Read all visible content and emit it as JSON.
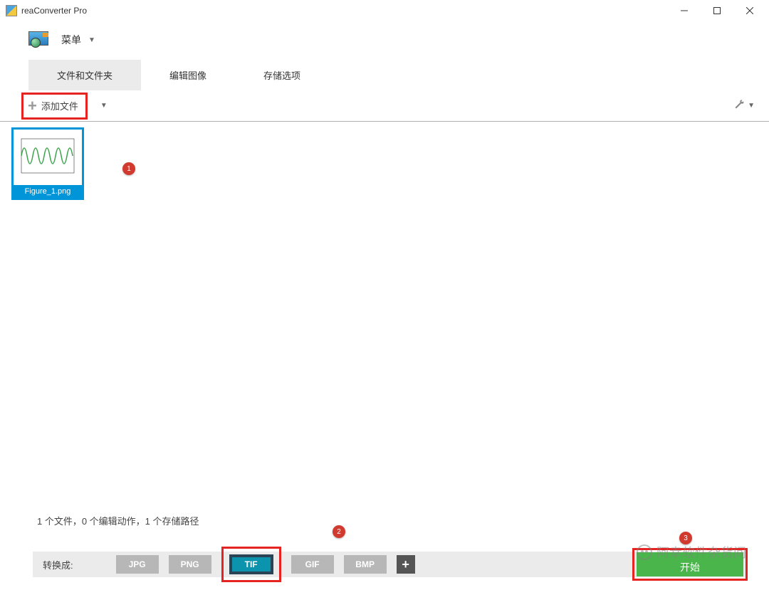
{
  "app": {
    "title": "reaConverter Pro"
  },
  "menu": {
    "label": "菜单"
  },
  "tabs": {
    "files": "文件和文件夹",
    "edit": "编辑图像",
    "save": "存储选项"
  },
  "toolbar": {
    "add_files": "添加文件"
  },
  "files": {
    "item_0": {
      "name": "Figure_1.png"
    }
  },
  "status": {
    "text": "1 个文件，0 个编辑动作，1 个存储路径"
  },
  "annotations": {
    "badge1": "1",
    "badge2": "2",
    "badge3": "3"
  },
  "convert": {
    "label": "转换成:",
    "formats": {
      "jpg": "JPG",
      "png": "PNG",
      "tif": "TIF",
      "gif": "GIF",
      "bmp": "BMP"
    },
    "selected": "TIF",
    "start": "开始"
  },
  "watermark": {
    "text": "阿幸软件杂货间"
  }
}
